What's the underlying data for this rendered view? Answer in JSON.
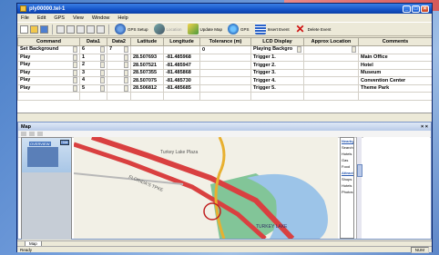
{
  "window": {
    "title": "ply00000.tel-1"
  },
  "menu": [
    "File",
    "Edit",
    "GPS",
    "View",
    "Window",
    "Help"
  ],
  "toolbar": {
    "buttons": [
      {
        "label": "GPS Setup"
      },
      {
        "label": "Location"
      },
      {
        "label": "Update Map"
      },
      {
        "label": "GPS"
      },
      {
        "label": "Insert Event"
      },
      {
        "label": "Delete Event"
      }
    ]
  },
  "grid": {
    "columns": [
      "Command",
      "Data1",
      "Data2",
      "Latitude",
      "Longitude",
      "Tolerance (m)",
      "LCD Display",
      "Approx Location",
      "Comments"
    ],
    "rows": [
      {
        "command": "Set Background",
        "data1": "6",
        "data2": "7",
        "lat": "",
        "lon": "",
        "tol": "0",
        "lcd": "Playing Backgro",
        "approx": "",
        "comment": ""
      },
      {
        "command": "Play",
        "data1": "1",
        "data2": "",
        "lat": "28.507693",
        "lon": "-81.485968",
        "tol": "",
        "lcd": "Trigger 1.",
        "approx": "",
        "comment": "Main Office"
      },
      {
        "command": "Play",
        "data1": "2",
        "data2": "",
        "lat": "28.507521",
        "lon": "-81.485947",
        "tol": "",
        "lcd": "Trigger 2.",
        "approx": "",
        "comment": "Hotel"
      },
      {
        "command": "Play",
        "data1": "3",
        "data2": "",
        "lat": "28.507355",
        "lon": "-81.485868",
        "tol": "",
        "lcd": "Trigger 3.",
        "approx": "",
        "comment": "Museum"
      },
      {
        "command": "Play",
        "data1": "4",
        "data2": "",
        "lat": "28.507075",
        "lon": "-81.485730",
        "tol": "",
        "lcd": "Trigger 4.",
        "approx": "",
        "comment": "Convention Center"
      },
      {
        "command": "Play",
        "data1": "5",
        "data2": "",
        "lat": "28.506812",
        "lon": "-81.485685",
        "tol": "",
        "lcd": "Trigger 5.",
        "approx": "",
        "comment": "Theme Park"
      },
      {
        "command": "",
        "data1": "",
        "data2": "",
        "lat": "",
        "lon": "",
        "tol": "",
        "lcd": "",
        "approx": "",
        "comment": ""
      }
    ]
  },
  "map": {
    "panel_title": "Map",
    "overview_label": "OVERVIEW",
    "overview_button": "Hide",
    "labels": {
      "road": "FLORIDA'S TPKE",
      "place": "Turkey Lake Plaza",
      "lake": "TURKEY LAKE"
    },
    "side_items": [
      "Nearby",
      "Search",
      "Hotels",
      "Gas",
      "Food",
      "Attractions",
      "Shops",
      "Hotels",
      "Photos"
    ]
  },
  "bottom_tab": "Map",
  "status": {
    "left": "Ready",
    "right": "NUM"
  }
}
